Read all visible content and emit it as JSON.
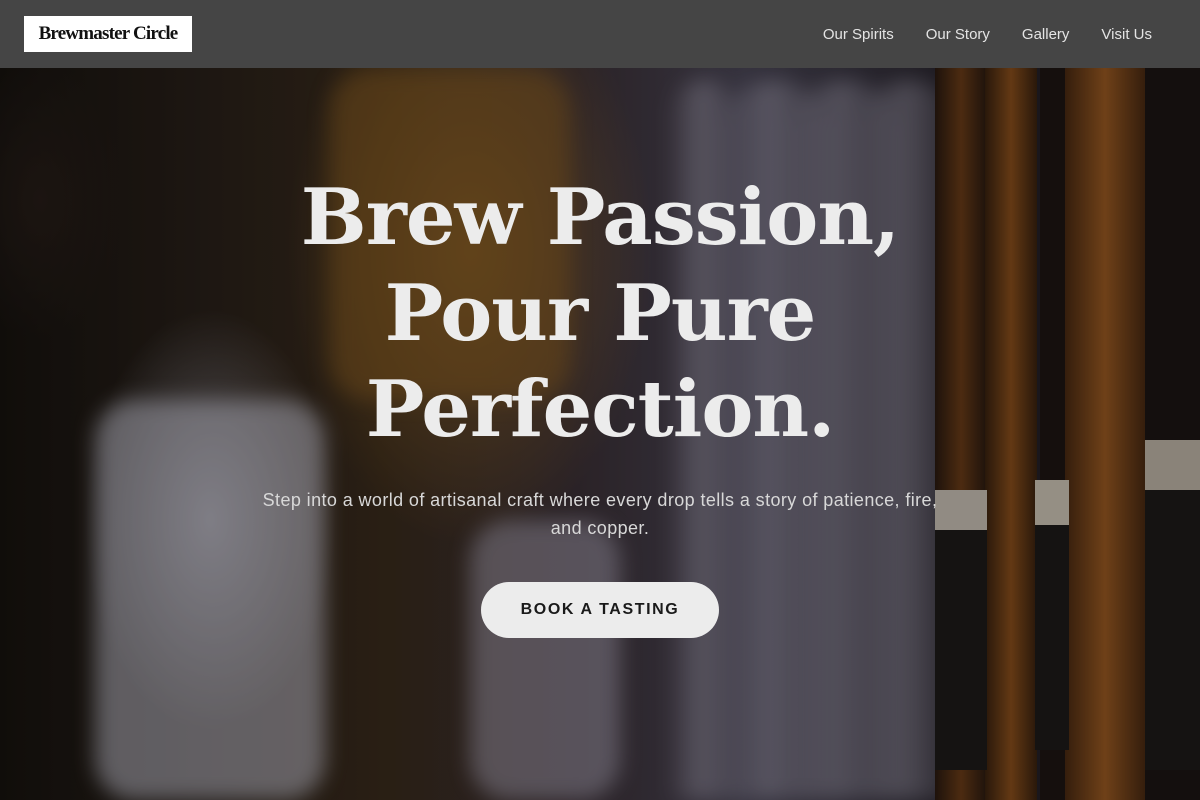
{
  "brand": {
    "name": "Brewmaster Circle"
  },
  "nav": {
    "links": [
      {
        "label": "Our Spirits"
      },
      {
        "label": "Our Story"
      },
      {
        "label": "Gallery"
      },
      {
        "label": "Visit Us"
      }
    ]
  },
  "hero": {
    "headline": [
      "Brew Passion,",
      "Pour Pure",
      "Perfection."
    ],
    "subtitle": "Step into a world of artisanal craft where every drop tells a story of patience, fire, and copper.",
    "cta_label": "BOOK A TASTING"
  },
  "colors": {
    "nav_background": "#454545",
    "brand_background": "#ffffff",
    "headline_text": "#ececec",
    "cta_background": "#ececec",
    "cta_text": "#1a1a1a"
  }
}
